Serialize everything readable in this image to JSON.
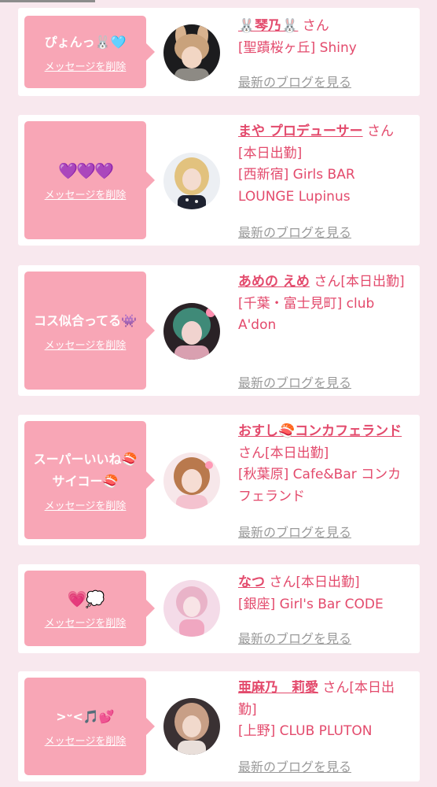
{
  "delete_label": "メッセージを削除",
  "blog_label": "最新のブログを見る",
  "colors": {
    "page_bg": "#f8e8ee",
    "bubble": "#f8a6b6",
    "accent_text": "#e34a6c",
    "blog_link": "#9a9a9a"
  },
  "entries": [
    {
      "message": "ぴょんっ🐰🩵",
      "name": "🐰琴乃🐰",
      "san": "さん",
      "shop": "[聖蹟桜ヶ丘] Shiny"
    },
    {
      "message": "💜💜💜",
      "name": "まや プロデューサー",
      "san": "さん[本日出勤]",
      "shop": "[西新宿] Girls BAR LOUNGE Lupinus"
    },
    {
      "message": "コス似合ってる👾",
      "name": "あめの えめ",
      "san": "さん[本日出勤]",
      "shop": "[千葉・富士見町] club A'don"
    },
    {
      "message": "スーパーいいね🍣\nサイコー🍣",
      "name": "おすし🍣コンカフェランド",
      "san": "さん[本日出勤]",
      "shop": "[秋葉原] Cafe&Bar コンカフェランド"
    },
    {
      "message": "💗💭",
      "name": "なつ",
      "san": "さん[本日出勤]",
      "shop": "[銀座] Girl's Bar CODE"
    },
    {
      "message": ">ᵕ<🎵💕",
      "name": "亜麻乃　莉愛",
      "san": "さん[本日出勤]",
      "shop": "[上野] CLUB PLUTON"
    }
  ]
}
